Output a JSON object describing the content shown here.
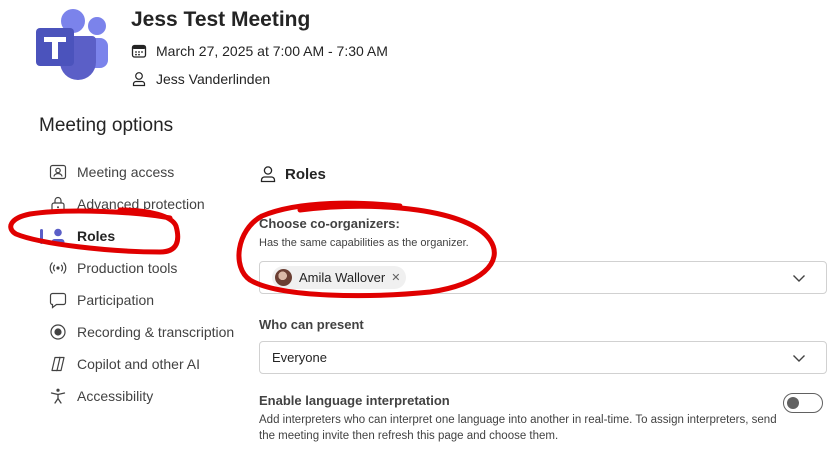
{
  "app": {
    "brand_color": "#5b5fc7",
    "logo_icon": "teams-logo-icon"
  },
  "meeting": {
    "title": "Jess Test Meeting",
    "datetime": "March 27, 2025 at 7:00 AM - 7:30 AM",
    "organizer": "Jess Vanderlinden"
  },
  "page": {
    "title": "Meeting options"
  },
  "nav": {
    "items": [
      {
        "label": "Meeting access",
        "icon": "meeting-access-icon"
      },
      {
        "label": "Advanced protection",
        "icon": "lock-icon"
      },
      {
        "label": "Roles",
        "icon": "person-icon",
        "active": true
      },
      {
        "label": "Production tools",
        "icon": "broadcast-icon"
      },
      {
        "label": "Participation",
        "icon": "chat-bubble-icon"
      },
      {
        "label": "Recording & transcription",
        "icon": "record-icon"
      },
      {
        "label": "Copilot and other AI",
        "icon": "copilot-icon"
      },
      {
        "label": "Accessibility",
        "icon": "accessibility-icon"
      }
    ]
  },
  "roles": {
    "heading": "Roles",
    "co_organizers": {
      "label": "Choose co-organizers:",
      "hint": "Has the same capabilities as the organizer.",
      "selected": [
        "Amila Wallover"
      ]
    },
    "who_can_present": {
      "label": "Who can present",
      "value": "Everyone"
    },
    "language_interpretation": {
      "label": "Enable language interpretation",
      "description": "Add interpreters who can interpret one language into another in real-time. To assign interpreters, send the meeting invite then refresh this page and choose them.",
      "enabled": false
    }
  },
  "annotation": {
    "color": "#e00000"
  }
}
